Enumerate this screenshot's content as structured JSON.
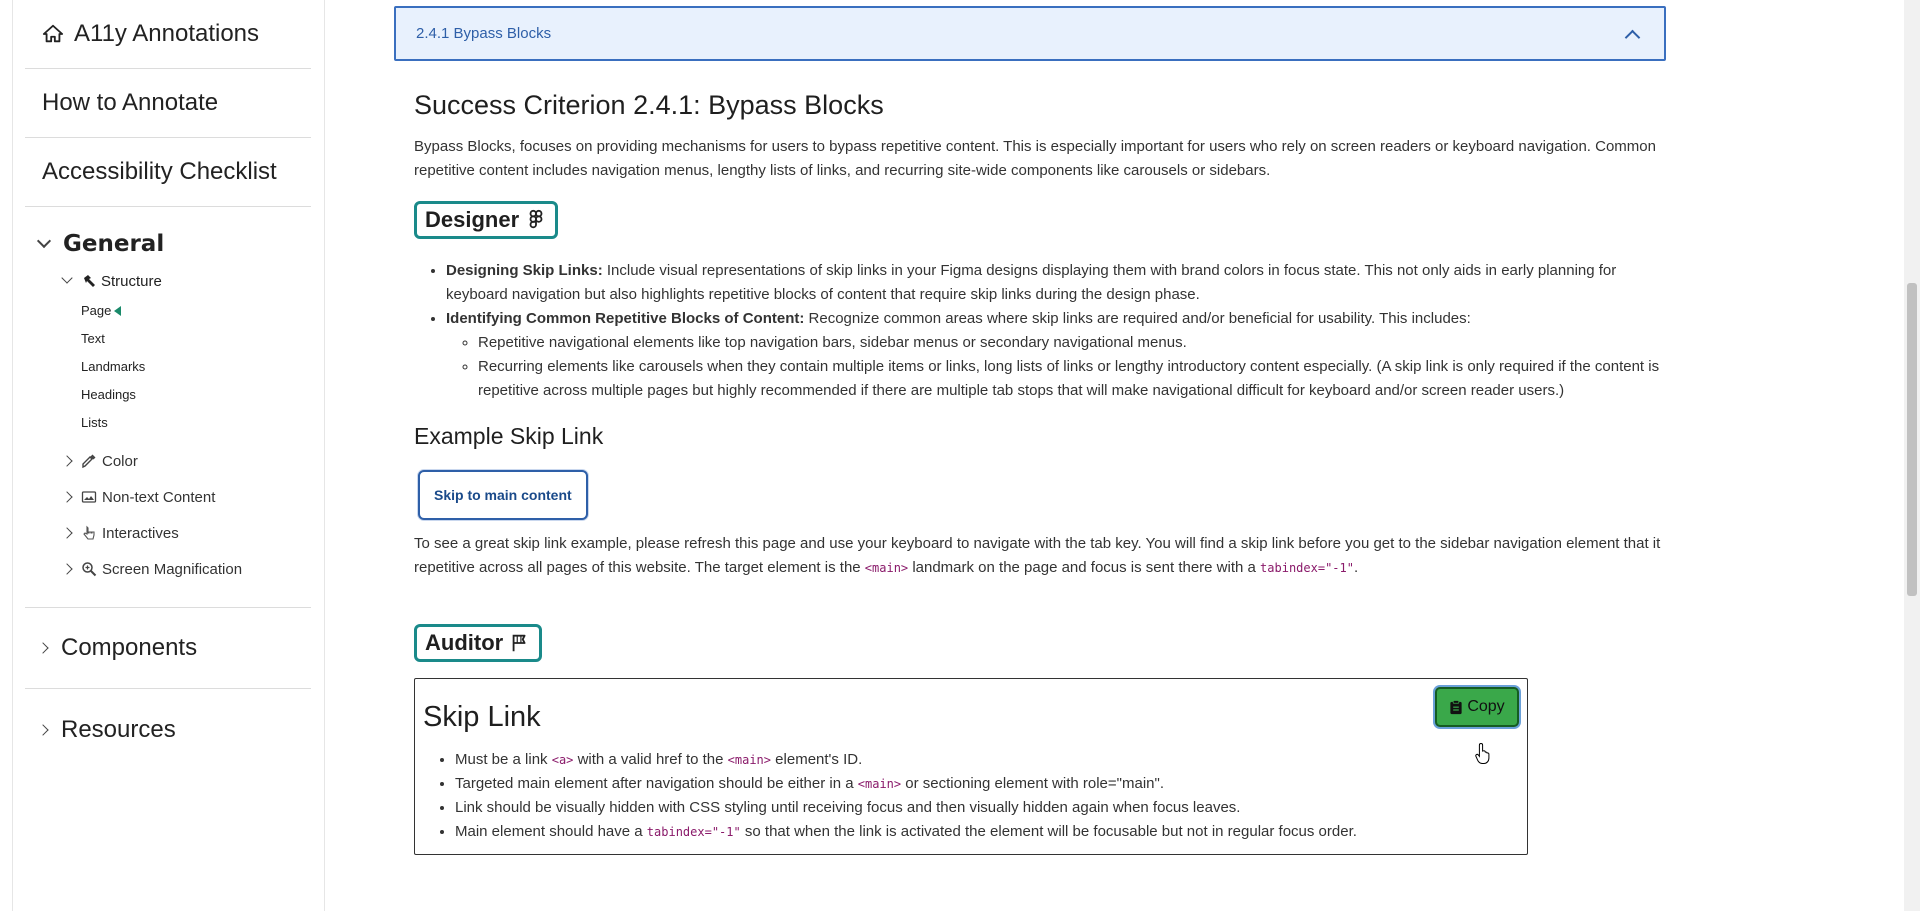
{
  "sidebar": {
    "home_label": "A11y Annotations",
    "how_to": "How to Annotate",
    "checklist": "Accessibility Checklist",
    "general": {
      "label": "General",
      "structure": {
        "label": "Structure",
        "items": [
          "Page",
          "Text",
          "Landmarks",
          "Headings",
          "Lists"
        ]
      },
      "collapsed": [
        {
          "label": "Color",
          "icon": "eyedropper-icon"
        },
        {
          "label": "Non-text Content",
          "icon": "image-icon"
        },
        {
          "label": "Interactives",
          "icon": "pointer-hand-icon"
        },
        {
          "label": "Screen Magnification",
          "icon": "zoom-icon"
        }
      ]
    },
    "components": "Components",
    "resources": "Resources"
  },
  "accordion": {
    "title": "2.4.1 Bypass Blocks"
  },
  "content": {
    "heading": "Success Criterion 2.4.1: Bypass Blocks",
    "intro": "Bypass Blocks, focuses on providing mechanisms for users to bypass repetitive content. This is especially important for users who rely on screen readers or keyboard navigation. Common repetitive content includes navigation menus, lengthy lists of links, and recurring site-wide components like carousels or sidebars.",
    "designer_label": "Designer",
    "designer_items": [
      {
        "strong": "Designing Skip Links:",
        "text": " Include visual representations of skip links in your Figma designs displaying them with brand colors in focus state. This not only aids in early planning for keyboard navigation but also highlights repetitive blocks of content that require skip links during the design phase."
      },
      {
        "strong": "Identifying Common Repetitive Blocks of Content:",
        "text": " Recognize common areas where skip links are required and/or beneficial for usability. This includes:"
      }
    ],
    "designer_subitems": [
      "Repetitive navigational elements like top navigation bars, sidebar menus or secondary navigational menus.",
      "Recurring elements like carousels when they contain multiple items or links, long lists of links or lengthy introductory content especially. (A skip link is only required if the content is repetitive across multiple pages but highly recommended if there are multiple tab stops that will make navigational difficult for keyboard and/or screen reader users.)"
    ],
    "example_heading": "Example Skip Link",
    "skip_button": "Skip to main content",
    "note_before": "To see a great skip link example, please refresh this page and use your keyboard to navigate with the tab key. You will find a skip link before you get to the sidebar navigation element that it repetitive across all pages of this website. The target element is the ",
    "note_code1": "<main>",
    "note_middle": " landmark on the page and focus is sent there with a ",
    "note_code2": "tabindex=\"-1\"",
    "note_after": ".",
    "auditor_label": "Auditor",
    "audit": {
      "title": "Skip Link",
      "copy": "Copy",
      "items": [
        {
          "a": "Must be a link ",
          "c1": "<a>",
          "b": " with a valid href to the ",
          "c2": "<main>",
          "d": " element's ID."
        },
        {
          "a": "Targeted main element after navigation should be either in a ",
          "c1": "<main>",
          "b": " or sectioning element with role=\"main\".",
          "c2": "",
          "d": ""
        },
        {
          "a": "Link should be visually hidden with CSS styling until receiving focus and then visually hidden again when focus leaves.",
          "c1": "",
          "b": "",
          "c2": "",
          "d": ""
        },
        {
          "a": "Main element should have a ",
          "c1": "tabindex=\"-1\"",
          "b": " so that when the link is activated the element will be focusable but not in regular focus order.",
          "c2": "",
          "d": ""
        }
      ]
    }
  },
  "colors": {
    "accent_teal": "#1a8a8a",
    "accordion_bg": "#e8f1fd",
    "accordion_border": "#3a6fbf",
    "copy_green": "#3aa84a"
  }
}
